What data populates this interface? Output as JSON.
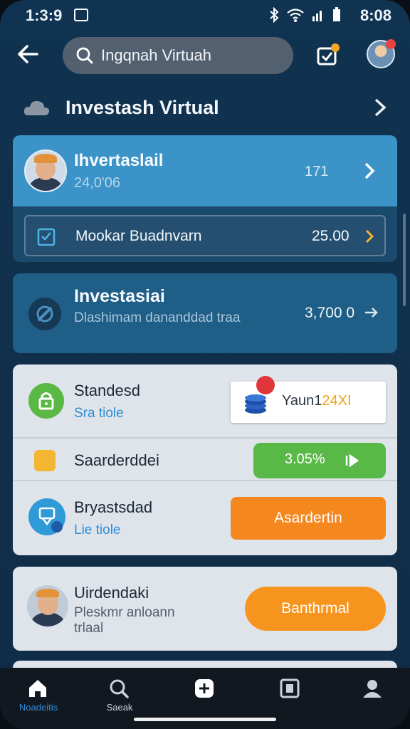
{
  "status_bar": {
    "time_left": "1:3:9",
    "time_right": "8:08"
  },
  "search": {
    "placeholder": "Ingqnah Virtuah"
  },
  "section": {
    "title": "Investash Virtual"
  },
  "card1": {
    "name": "Ihvertaslail",
    "sub": "24,0'06",
    "count": "171",
    "inner_label": "Mookar Buadnvarn",
    "inner_value": "25.00"
  },
  "card2": {
    "title": "Investasiai",
    "desc": "Dlashimam dananddad traa",
    "value": "3,700 0"
  },
  "rows": [
    {
      "title": "Standesd",
      "sub": "Sra tiole",
      "chip_prefix": "Yaun1",
      "chip_highlight": "24XI"
    },
    {
      "title": "Saarderddei",
      "pill_value": "3.05%"
    },
    {
      "title": "Bryastsdad",
      "sub": "Lie tiole",
      "button": "Asardertin"
    }
  ],
  "card4": {
    "title": "Uirdendaki",
    "desc": "Pleskmr anloann trlaal",
    "button": "Banthrmal"
  },
  "nav": [
    {
      "label": "Noadeitis"
    },
    {
      "label": "Saeak"
    },
    {
      "label": ""
    },
    {
      "label": ""
    },
    {
      "label": ""
    }
  ],
  "colors": {
    "background": "#11304c",
    "highlight_card": "#3b93c8",
    "green": "#58b947",
    "orange": "#f5871f",
    "accent_blue": "#2d8ed4",
    "nav_active": "#2f8de0"
  }
}
